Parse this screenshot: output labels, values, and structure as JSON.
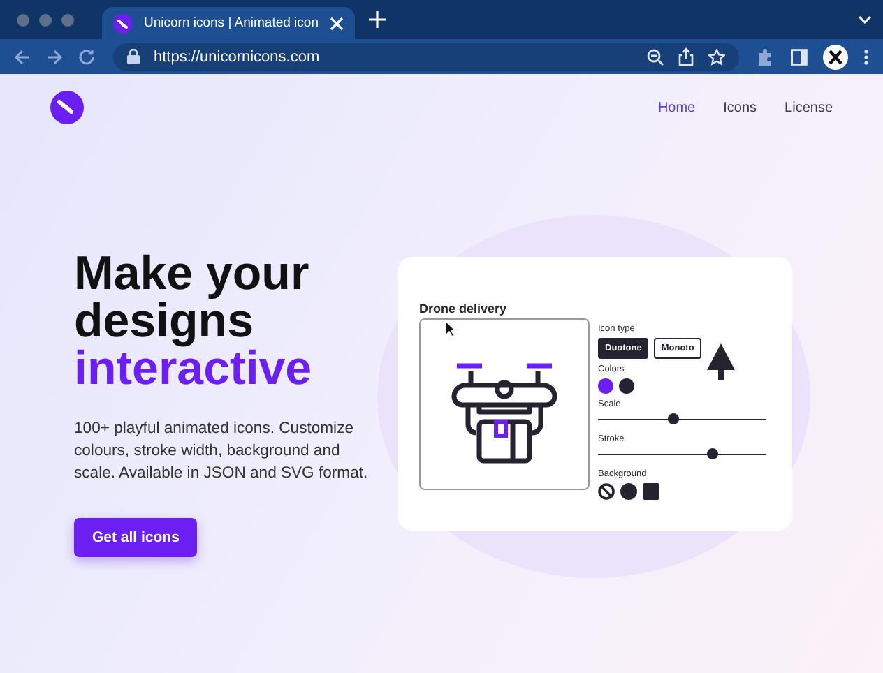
{
  "browser": {
    "tabs": [
      {
        "title": "Unicorn icons | Animated icon",
        "selected": true
      }
    ],
    "url": "https://unicornicons.com"
  },
  "nav": [
    {
      "label": "Home",
      "selected": true
    },
    {
      "label": "Icons",
      "selected": false
    },
    {
      "label": "License",
      "selected": false
    }
  ],
  "hero": {
    "title_lines": [
      "Make your",
      "designs"
    ],
    "highlight": "interactive",
    "description": "100+ playful animated icons. Customize colours, stroke width, background and scale. Available in JSON and SVG format.",
    "button": "Get all icons"
  },
  "demo": {
    "title": "Drone delivery",
    "icon_type_label": "Icon type",
    "icon_types": [
      {
        "label": "Duotone",
        "selected": true
      },
      {
        "label": "Monoto",
        "selected": false
      }
    ],
    "colors_label": "Colors",
    "colors": [
      {
        "color": "#6b1ff0"
      },
      {
        "color": "#24232f"
      }
    ],
    "sliders": [
      {
        "label": "Scale",
        "level": 0.45
      },
      {
        "label": "Stroke",
        "level": 0.68
      }
    ],
    "background_label": "Background",
    "backgrounds": [
      {
        "kind": "none"
      },
      {
        "kind": "circle"
      },
      {
        "kind": "square"
      }
    ]
  }
}
